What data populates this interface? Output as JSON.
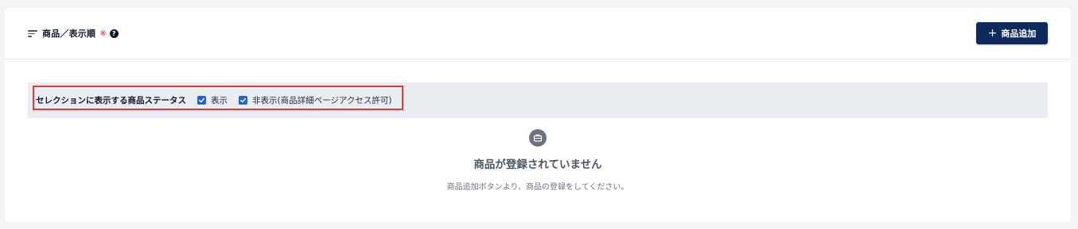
{
  "header": {
    "title": "商品／表示順",
    "required_mark": "※",
    "help_icon": "help-circle-icon",
    "add_button_label": "商品追加",
    "add_button_icon": "+"
  },
  "status_filter": {
    "label": "セレクションに表示する商品ステータス",
    "options": [
      {
        "label": "表示",
        "checked": true
      },
      {
        "label": "非表示(商品詳細ページアクセス許可)",
        "checked": true
      }
    ]
  },
  "empty_state": {
    "icon": "briefcase-icon",
    "title": "商品が登録されていません",
    "description": "商品追加ボタンより、商品の登録をしてください。"
  },
  "colors": {
    "primary_button": "#0e2a5c",
    "checkbox": "#1e63d6",
    "highlight_border": "#e53935",
    "required_mark": "#e11d48",
    "status_bar_bg": "#eaedf1"
  }
}
